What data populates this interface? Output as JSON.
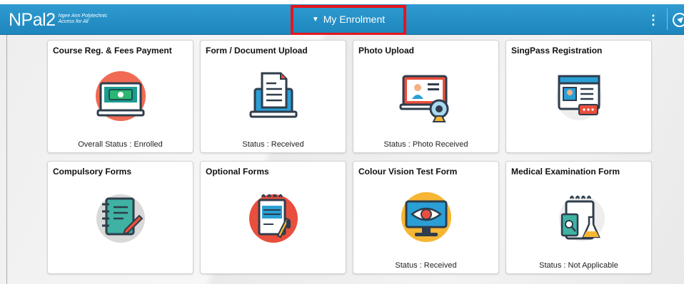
{
  "header": {
    "logo_mark": "NPal2",
    "logo_line1": "Ngee Ann Polytechnic",
    "logo_line2": "Access for All",
    "title": "My Enrolment",
    "caret": "▼",
    "kebab": "⋮"
  },
  "tiles": [
    {
      "title": "Course Reg. & Fees Payment",
      "status": "Overall Status :  Enrolled"
    },
    {
      "title": "Form / Document Upload",
      "status": "Status :  Received"
    },
    {
      "title": "Photo Upload",
      "status": "Status :  Photo Received"
    },
    {
      "title": "SingPass Registration",
      "status": ""
    },
    {
      "title": "Compulsory Forms",
      "status": ""
    },
    {
      "title": "Optional Forms",
      "status": ""
    },
    {
      "title": "Colour Vision Test Form",
      "status": "Status :  Received"
    },
    {
      "title": "Medical Examination Form",
      "status": "Status :  Not Applicable"
    }
  ],
  "colors": {
    "header_blue": "#2f9bd0",
    "highlight_red": "#e8141a"
  }
}
